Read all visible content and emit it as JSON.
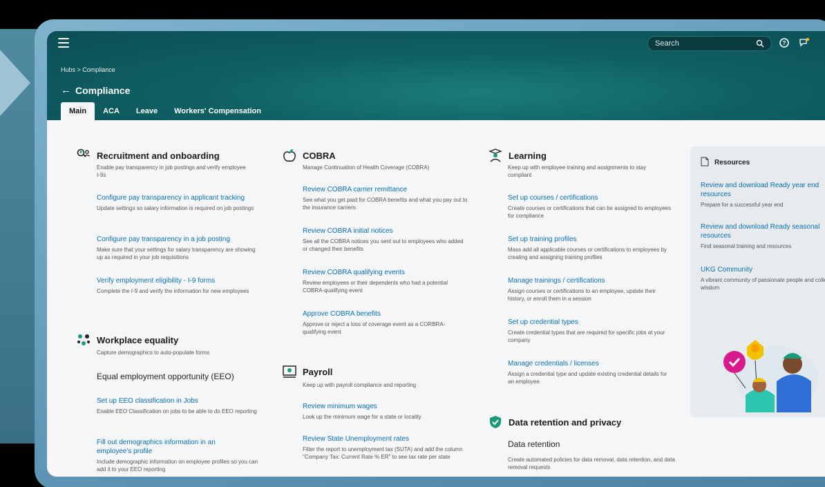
{
  "header": {
    "search_placeholder": "Search",
    "breadcrumb": "Hubs > Compliance",
    "title": "Compliance",
    "tabs": [
      "Main",
      "ACA",
      "Leave",
      "Workers' Compensation"
    ]
  },
  "sections": {
    "recruitment": {
      "title": "Recruitment and onboarding",
      "desc": "Enable pay transparency in job postings and verify employee I-9s",
      "items": [
        {
          "link": "Configure pay transparency in applicant tracking",
          "desc": "Update settings so salary information is required on job postings"
        },
        {
          "link": "Configure pay transparency in a job posting",
          "desc": "Make sure that your settings for salary transparency are showing up as required in your job requisitions"
        },
        {
          "link": "Verify employment eligibility - I-9 forms",
          "desc": "Complete the I-9 and verify the information for new employees"
        }
      ]
    },
    "workplace": {
      "title": "Workplace equality",
      "desc": "Capture demographics to auto-populate forms",
      "subheading": "Equal employment opportunity (EEO)",
      "items": [
        {
          "link": "Set up EEO classification in Jobs",
          "desc": "Enable EEO Classification on jobs to be able to do EEO reporting"
        },
        {
          "link": "Fill out demographics information in an employee's profile",
          "desc": "Include demographic information on employee profiles so you can add it to your EEO reporting"
        }
      ]
    },
    "cobra": {
      "title": "COBRA",
      "desc": "Manage Continuation of Health Coverage (COBRA)",
      "items": [
        {
          "link": "Review COBRA carrier remittance",
          "desc": "See what you get paid for COBRA benefits and what you pay out to the insurance carriers"
        },
        {
          "link": "Review COBRA initial notices",
          "desc": "See all the COBRA notices you sent out to employees who added or changed their benefits"
        },
        {
          "link": "Review COBRA qualifying events",
          "desc": "Review employees or their dependents who had a potential COBRA-qualifying event"
        },
        {
          "link": "Approve COBRA benefits",
          "desc": "Approve or reject a loss of coverage event as a CORBRA-qualifying event"
        }
      ]
    },
    "payroll": {
      "title": "Payroll",
      "desc": "Keep up with payroll compliance and reporting",
      "items": [
        {
          "link": "Review minimum wages",
          "desc": "Look up the minimum wage for a state or locality"
        },
        {
          "link": "Review State Unemployment rates",
          "desc": "Filter the report to unemployment tax (SUTA) and add the column \"Company Tax: Current Rate % ER\" to see tax rate per state"
        }
      ]
    },
    "learning": {
      "title": "Learning",
      "desc": "Keep up with employee training and assignments to stay compliant",
      "items": [
        {
          "link": "Set up courses / certifications",
          "desc": "Create courses or certifications that can be assigned to employees for compliance"
        },
        {
          "link": "Set up training profiles",
          "desc": "Mass add all applicable courses or certifications to employees by creating and assigning training profiles"
        },
        {
          "link": "Manage trainings / certifications",
          "desc": "Assign courses or certifications to an employee, update their history, or enroll them in a session"
        },
        {
          "link": "Set up credential types",
          "desc": "Create credential types that are required for specific jobs at your company"
        },
        {
          "link": "Manage credentials / licenses",
          "desc": "Assign a credential type and update existing credential details for an employee"
        }
      ]
    },
    "data_retention": {
      "title": "Data retention and privacy",
      "subheading": "Data retention",
      "desc": "Create automated policies for data removal, data retention, and data removal requests"
    }
  },
  "resources": {
    "title": "Resources",
    "items": [
      {
        "link": "Review and download Ready year end resources",
        "desc": "Prepare for a successful year end"
      },
      {
        "link": "Review and download Ready seasonal resources",
        "desc": "Find seasonal training and resources"
      },
      {
        "link": "UKG Community",
        "desc": "A vibrant community of passionate people and collective wisdom"
      }
    ]
  },
  "colors": {
    "header_bg": "#0f6063",
    "link": "#0b6fb2",
    "accent_green": "#1a9a7a"
  }
}
